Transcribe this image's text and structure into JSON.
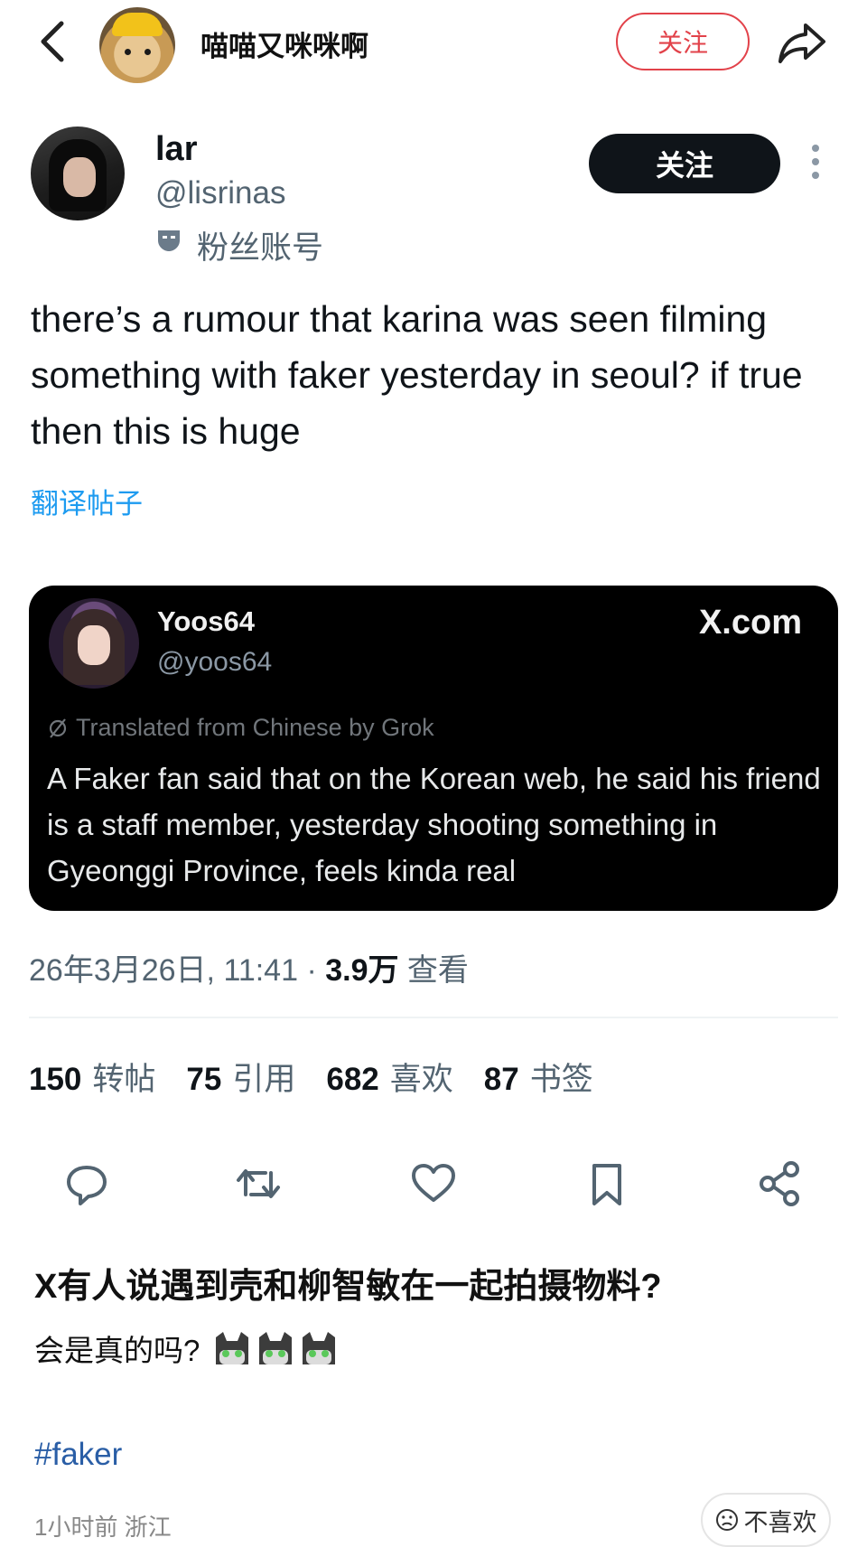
{
  "topbar": {
    "owner_name": "喵喵又咪咪啊",
    "follow_label": "关注"
  },
  "tweet": {
    "name": "lar",
    "handle": "@lisrinas",
    "badge": "粉丝账号",
    "follow_label": "关注",
    "text": "there’s a rumour that karina was seen filming something with faker yesterday in seoul? if true then this is huge",
    "translate_label": "翻译帖子",
    "quoted": {
      "name": "Yoos64",
      "handle": "@yoos64",
      "source": "X.com",
      "grok_note": "Translated from Chinese by Grok",
      "text": "A Faker fan said that on the Korean web, he said his friend is a staff member, yesterday shooting something in Gyeonggi Province, feels kinda real"
    },
    "date_time": "26年3月26日, 11:41 · ",
    "views_count": "3.9万",
    "views_label": " 查看",
    "stats": [
      {
        "count": "150",
        "label": "转帖"
      },
      {
        "count": "75",
        "label": "引用"
      },
      {
        "count": "682",
        "label": "喜欢"
      },
      {
        "count": "87",
        "label": "书签"
      }
    ]
  },
  "post": {
    "title": "X有人说遇到壳和柳智敏在一起拍摄物料?",
    "body": "会是真的吗?",
    "hashtag": "#faker",
    "meta": "1小时前  浙江",
    "dislike_label": "不喜欢"
  },
  "colors": {
    "accent_red": "#e2424a",
    "link_blue": "#1d9bf0",
    "hashtag_blue": "#2a5ea6",
    "muted": "#536471"
  }
}
